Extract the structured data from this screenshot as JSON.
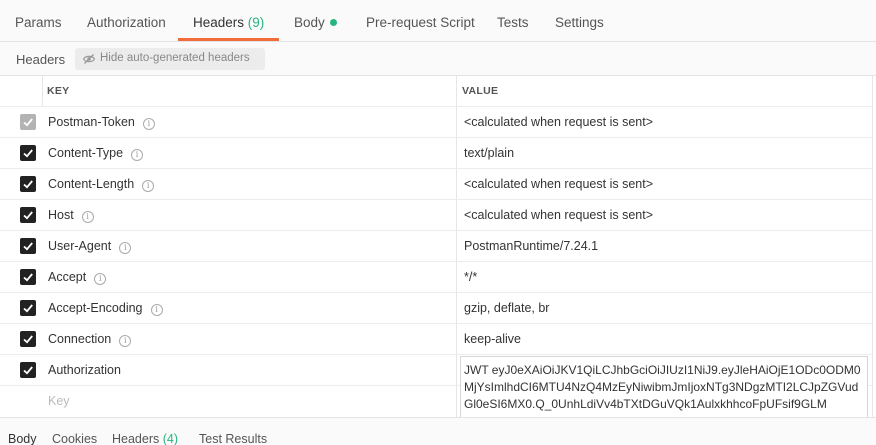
{
  "tabs": {
    "params": "Params",
    "authorization": "Authorization",
    "headers": "Headers",
    "headers_count": "(9)",
    "body": "Body",
    "prerequest": "Pre-request Script",
    "tests": "Tests",
    "settings": "Settings"
  },
  "headers_section": {
    "title": "Headers",
    "hide_button": "Hide auto-generated headers",
    "hide_icon": "eye-slash-icon"
  },
  "table": {
    "key_header": "KEY",
    "value_header": "VALUE",
    "rows": [
      {
        "key": "Postman-Token",
        "value": "<calculated when request is sent>",
        "checked": true,
        "disabled": true
      },
      {
        "key": "Content-Type",
        "value": "text/plain",
        "checked": true
      },
      {
        "key": "Content-Length",
        "value": "<calculated when request is sent>",
        "checked": true
      },
      {
        "key": "Host",
        "value": "<calculated when request is sent>",
        "checked": true
      },
      {
        "key": "User-Agent",
        "value": "PostmanRuntime/7.24.1",
        "checked": true
      },
      {
        "key": "Accept",
        "value": "*/*",
        "checked": true
      },
      {
        "key": "Accept-Encoding",
        "value": "gzip, deflate, br",
        "checked": true
      },
      {
        "key": "Connection",
        "value": "keep-alive",
        "checked": true
      },
      {
        "key": "Authorization",
        "value": "JWT eyJ0eXAiOiJKV1QiLCJhbGciOiJIUzI1NiJ9.eyJleHAiOjE1ODc0ODM0MjYsImlhdCI6MTU4NzQ4MzEyNiwibmJmIjoxNTg3NDgzMTI2LCJpZGVudGl0eSI6MX0.Q_0UnhLdiVv4bTXtDGuVQk1AulxkhhcoFpUFsif9GLM",
        "checked": true
      }
    ],
    "new_key_placeholder": "Key"
  },
  "bottom_tabs": {
    "body": "Body",
    "cookies": "Cookies",
    "headers": "Headers",
    "headers_count": "(4)",
    "test_results": "Test Results"
  },
  "colors": {
    "accent": "#f26b3a",
    "count_green": "#26b47f"
  }
}
